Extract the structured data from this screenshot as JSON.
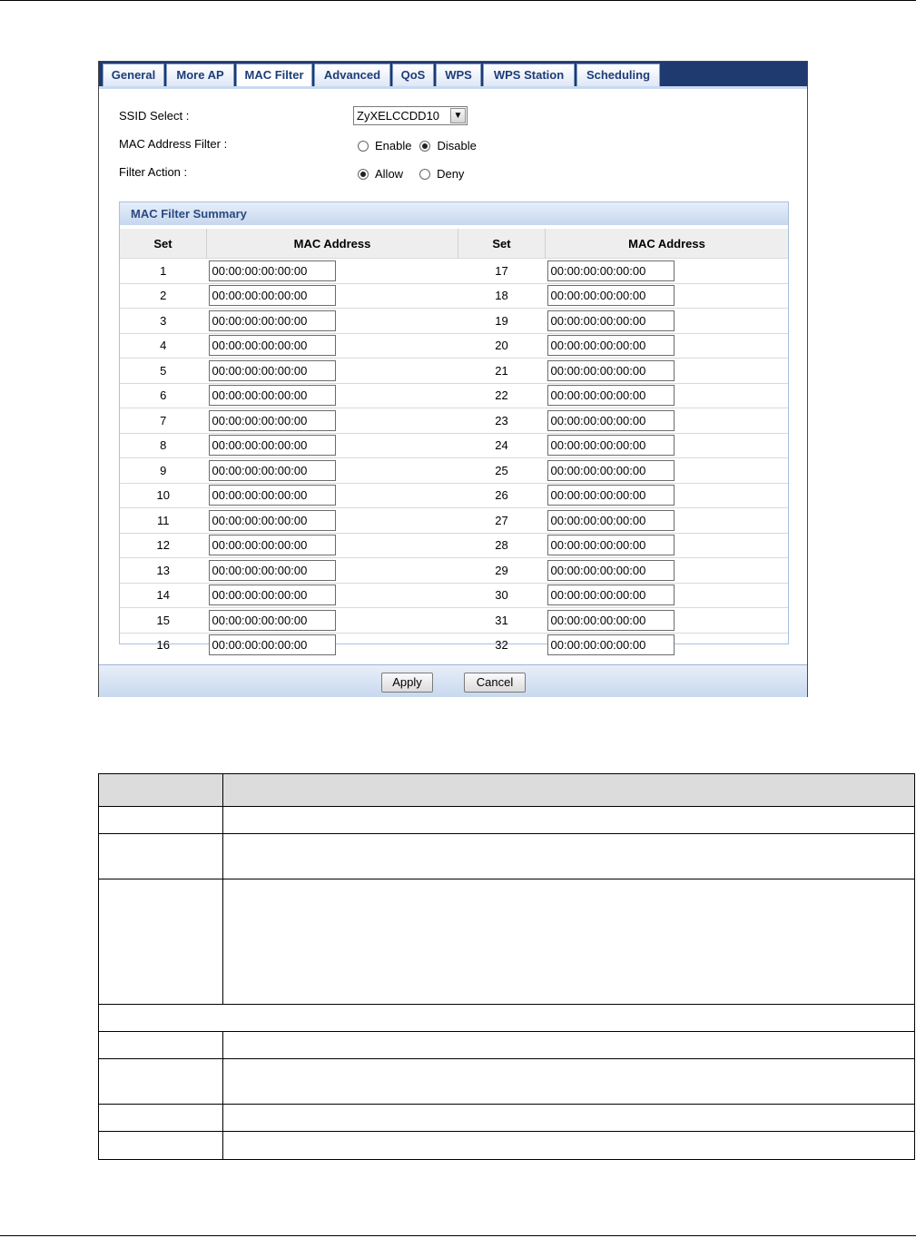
{
  "tabs": [
    {
      "label": "General"
    },
    {
      "label": "More AP"
    },
    {
      "label": "MAC Filter",
      "active": true
    },
    {
      "label": "Advanced"
    },
    {
      "label": "QoS"
    },
    {
      "label": "WPS"
    },
    {
      "label": "WPS Station"
    },
    {
      "label": "Scheduling"
    }
  ],
  "form": {
    "ssid_label": "SSID Select :",
    "ssid_value": "ZyXELCCDD10",
    "filter_label": "MAC Address Filter :",
    "filter_enable": "Enable",
    "filter_disable": "Disable",
    "filter_selected": "Disable",
    "action_label": "Filter Action :",
    "action_allow": "Allow",
    "action_deny": "Deny",
    "action_selected": "Allow"
  },
  "summary": {
    "title": "MAC Filter Summary",
    "col_set": "Set",
    "col_mac": "MAC Address",
    "rows": [
      {
        "left_set": "1",
        "left_mac": "00:00:00:00:00:00",
        "right_set": "17",
        "right_mac": "00:00:00:00:00:00"
      },
      {
        "left_set": "2",
        "left_mac": "00:00:00:00:00:00",
        "right_set": "18",
        "right_mac": "00:00:00:00:00:00"
      },
      {
        "left_set": "3",
        "left_mac": "00:00:00:00:00:00",
        "right_set": "19",
        "right_mac": "00:00:00:00:00:00"
      },
      {
        "left_set": "4",
        "left_mac": "00:00:00:00:00:00",
        "right_set": "20",
        "right_mac": "00:00:00:00:00:00"
      },
      {
        "left_set": "5",
        "left_mac": "00:00:00:00:00:00",
        "right_set": "21",
        "right_mac": "00:00:00:00:00:00"
      },
      {
        "left_set": "6",
        "left_mac": "00:00:00:00:00:00",
        "right_set": "22",
        "right_mac": "00:00:00:00:00:00"
      },
      {
        "left_set": "7",
        "left_mac": "00:00:00:00:00:00",
        "right_set": "23",
        "right_mac": "00:00:00:00:00:00"
      },
      {
        "left_set": "8",
        "left_mac": "00:00:00:00:00:00",
        "right_set": "24",
        "right_mac": "00:00:00:00:00:00"
      },
      {
        "left_set": "9",
        "left_mac": "00:00:00:00:00:00",
        "right_set": "25",
        "right_mac": "00:00:00:00:00:00"
      },
      {
        "left_set": "10",
        "left_mac": "00:00:00:00:00:00",
        "right_set": "26",
        "right_mac": "00:00:00:00:00:00"
      },
      {
        "left_set": "11",
        "left_mac": "00:00:00:00:00:00",
        "right_set": "27",
        "right_mac": "00:00:00:00:00:00"
      },
      {
        "left_set": "12",
        "left_mac": "00:00:00:00:00:00",
        "right_set": "28",
        "right_mac": "00:00:00:00:00:00"
      },
      {
        "left_set": "13",
        "left_mac": "00:00:00:00:00:00",
        "right_set": "29",
        "right_mac": "00:00:00:00:00:00"
      },
      {
        "left_set": "14",
        "left_mac": "00:00:00:00:00:00",
        "right_set": "30",
        "right_mac": "00:00:00:00:00:00"
      },
      {
        "left_set": "15",
        "left_mac": "00:00:00:00:00:00",
        "right_set": "31",
        "right_mac": "00:00:00:00:00:00"
      },
      {
        "left_set": "16",
        "left_mac": "00:00:00:00:00:00",
        "right_set": "32",
        "right_mac": "00:00:00:00:00:00"
      }
    ]
  },
  "buttons": {
    "apply": "Apply",
    "cancel": "Cancel"
  },
  "colors": {
    "tabbar": "#1e3a6e",
    "tab_text": "#1e3c78",
    "summary_header": "#2b4a80",
    "footer": "#c8d8ee"
  }
}
